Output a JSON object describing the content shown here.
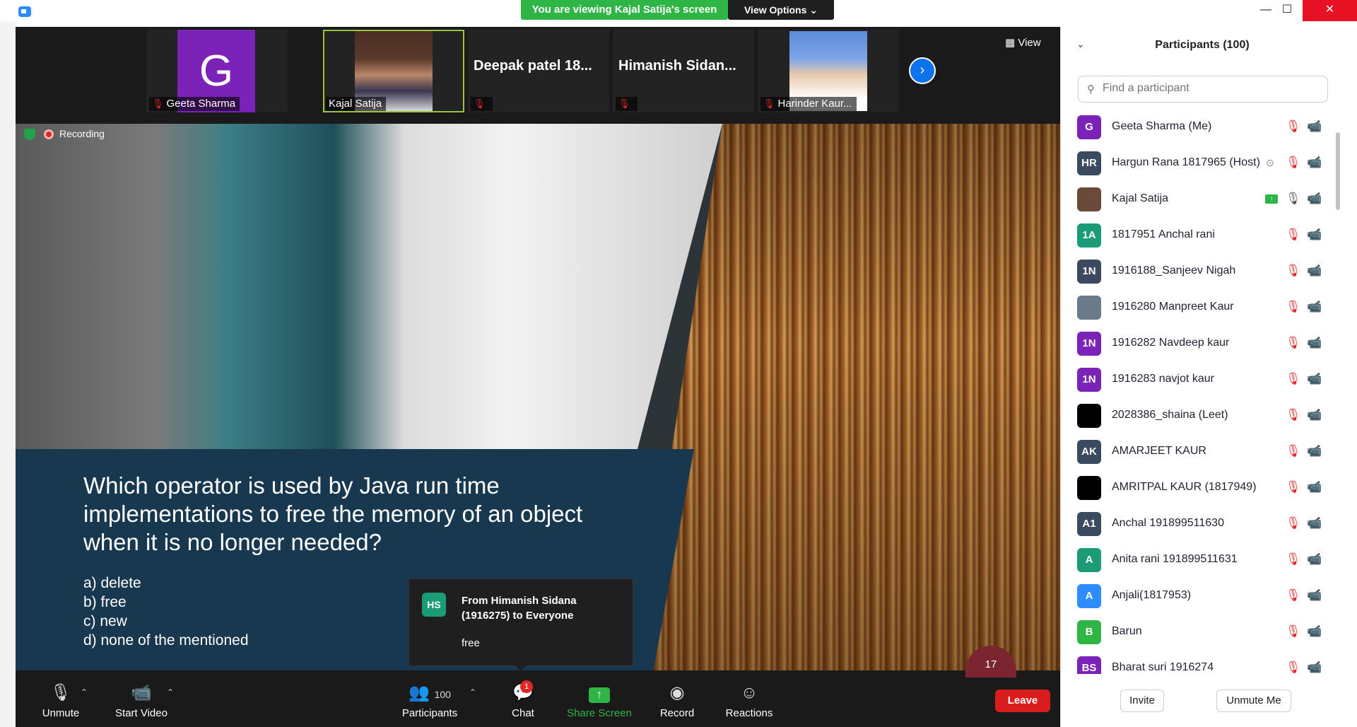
{
  "window": {
    "viewing_banner": "You are viewing Kajal Satija's screen",
    "view_options_label": "View Options",
    "minimize_glyph": "—",
    "maximize_glyph": "☐",
    "close_glyph": "✕"
  },
  "thumbnails": [
    {
      "name": "Geeta Sharma",
      "avatar_letter": "G",
      "avatar_color": "#7b22b8"
    },
    {
      "name": "Kajal Satija"
    },
    {
      "name": "Deepak patel 18..."
    },
    {
      "name": "Himanish  Sidan..."
    },
    {
      "name": "Harinder Kaur..."
    }
  ],
  "strip": {
    "view_label": "View",
    "next_icon": "chevron-right-icon"
  },
  "shared_screen": {
    "recording_label": "Recording",
    "question": "Which operator is used by Java run time implementations to free the memory of an object when it is no longer needed?",
    "options": [
      "a) delete",
      "b) free",
      "c) new",
      "d) none of the mentioned"
    ],
    "page_badge": "17"
  },
  "chat_toast": {
    "avatar": "HS",
    "avatar_color": "#1b9c76",
    "header": "From Himanish Sidana (1916275) to Everyone",
    "message": "free"
  },
  "toolbar": {
    "unmute_label": "Unmute",
    "start_video_label": "Start Video",
    "participants_label": "Participants",
    "participants_count": "100",
    "chat_label": "Chat",
    "chat_badge": "1",
    "share_screen_label": "Share Screen",
    "record_label": "Record",
    "reactions_label": "Reactions",
    "leave_label": "Leave",
    "colors": {
      "share": "#2fb545",
      "leave": "#d91c1c"
    }
  },
  "panel": {
    "title": "Participants (100)",
    "search_placeholder": "Find a participant",
    "invite_label": "Invite",
    "unmute_me_label": "Unmute Me"
  },
  "participants": [
    {
      "name": "Geeta Sharma (Me)",
      "avatar": "G",
      "color": "#7b22b8",
      "mic": "muted",
      "cam": "off"
    },
    {
      "name": "Hargun Rana 1817965 (Host)",
      "avatar": "HR",
      "color": "#3b4a5e",
      "mic": "muted",
      "cam": "off",
      "host_icon": true
    },
    {
      "name": "Kajal Satija",
      "avatar": "",
      "color": "#6b4a3a",
      "mic": "on",
      "cam": "off",
      "sharing": true
    },
    {
      "name": "1817951 Anchal rani",
      "avatar": "1A",
      "color": "#1b9c76",
      "mic": "muted",
      "cam": "off"
    },
    {
      "name": "1916188_Sanjeev Nigah",
      "avatar": "1N",
      "color": "#3b4a5e",
      "mic": "muted",
      "cam": "off"
    },
    {
      "name": "1916280 Manpreet Kaur",
      "avatar": "",
      "color": "#6a7a8a",
      "mic": "muted",
      "cam": "off"
    },
    {
      "name": "1916282 Navdeep kaur",
      "avatar": "1N",
      "color": "#7b22b8",
      "mic": "muted",
      "cam": "off"
    },
    {
      "name": "1916283 navjot kaur",
      "avatar": "1N",
      "color": "#7b22b8",
      "mic": "muted",
      "cam": "off"
    },
    {
      "name": "2028386_shaina (Leet)",
      "avatar": "",
      "color": "#000000",
      "mic": "muted",
      "cam": "off"
    },
    {
      "name": "AMARJEET KAUR",
      "avatar": "AK",
      "color": "#3b4a5e",
      "mic": "muted",
      "cam": "off"
    },
    {
      "name": "AMRITPAL KAUR (1817949)",
      "avatar": "",
      "color": "#000000",
      "mic": "muted",
      "cam": "off"
    },
    {
      "name": "Anchal 191899511630",
      "avatar": "A1",
      "color": "#3b4a5e",
      "mic": "muted",
      "cam": "off"
    },
    {
      "name": "Anita rani 191899511631",
      "avatar": "A",
      "color": "#1b9c76",
      "mic": "muted",
      "cam": "off"
    },
    {
      "name": "Anjali(1817953)",
      "avatar": "A",
      "color": "#2d8cff",
      "mic": "muted",
      "cam": "off"
    },
    {
      "name": "Barun",
      "avatar": "B",
      "color": "#2fb545",
      "mic": "muted",
      "cam": "off"
    },
    {
      "name": "Bharat suri 1916274",
      "avatar": "BS",
      "color": "#7b22b8",
      "mic": "muted",
      "cam": "off"
    }
  ]
}
